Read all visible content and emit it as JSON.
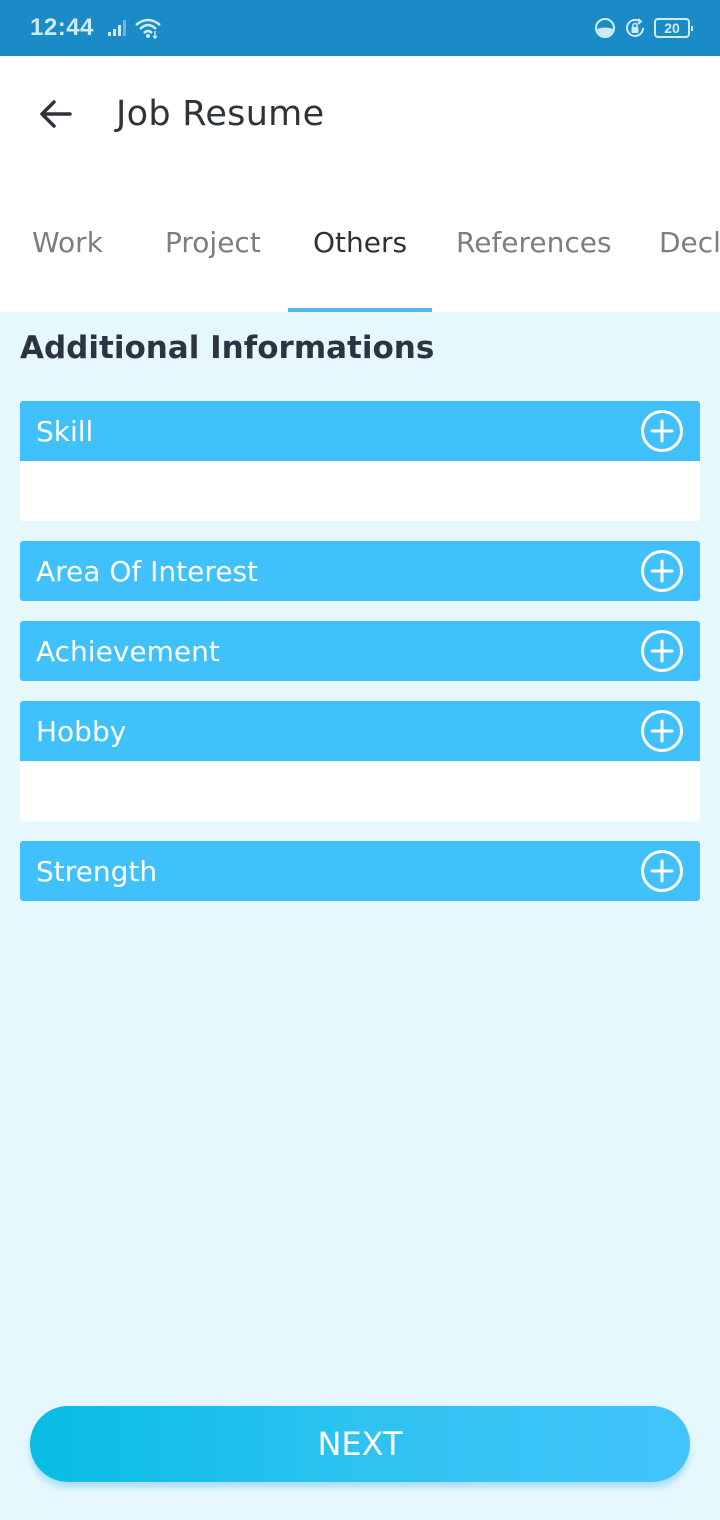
{
  "status_bar": {
    "time": "12:44",
    "battery_level": "20",
    "icons": [
      "signal-icon",
      "wifi-icon",
      "data-saver-icon",
      "rotation-lock-icon",
      "battery-icon"
    ]
  },
  "header": {
    "title": "Job Resume",
    "back_icon": "arrow-left-icon"
  },
  "tabs": [
    {
      "label": "Work",
      "active": false
    },
    {
      "label": "Project",
      "active": false
    },
    {
      "label": "Others",
      "active": true
    },
    {
      "label": "References",
      "active": false
    },
    {
      "label": "Decl",
      "active": false
    }
  ],
  "main": {
    "section_title": "Additional Informations",
    "sections": [
      {
        "label": "Skill",
        "has_body": true
      },
      {
        "label": "Area Of Interest",
        "has_body": false
      },
      {
        "label": "Achievement",
        "has_body": false
      },
      {
        "label": "Hobby",
        "has_body": true
      },
      {
        "label": "Strength",
        "has_body": false
      }
    ]
  },
  "footer": {
    "next_label": "NEXT"
  },
  "colors": {
    "status_bar": "#1a8bc6",
    "accent": "#40c1fb",
    "tab_indicator": "#52b9ea",
    "background": "#e6f7fe"
  }
}
